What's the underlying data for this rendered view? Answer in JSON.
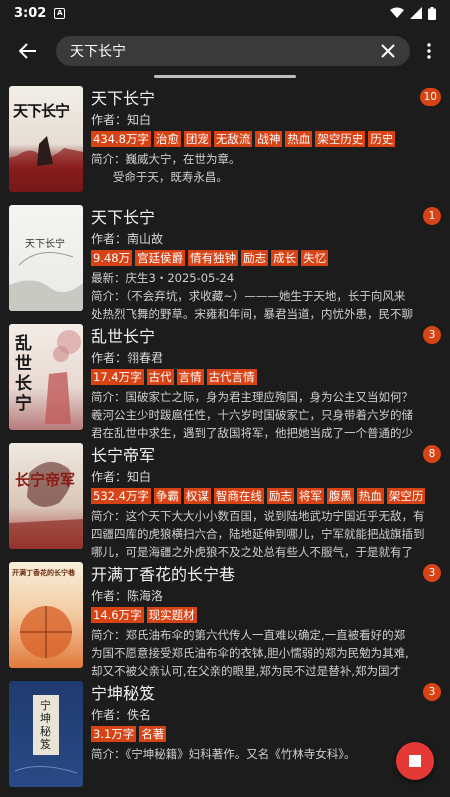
{
  "status": {
    "time": "3:02",
    "notif_letter": "A"
  },
  "search": {
    "value": "天下长宁"
  },
  "results": [
    {
      "title": "天下长宁",
      "author_label": "作者：",
      "author": "知白",
      "tags": [
        "434.8万字",
        "治愈",
        "团宠",
        "无敌流",
        "战神",
        "热血",
        "架空历史",
        "历史"
      ],
      "desc_line1": "简介：巍威大宁，在世为章。",
      "desc_line2": "      受命于天，既寿永昌。",
      "badge": "10",
      "cover_text": "天下长宁"
    },
    {
      "title": "天下长宁",
      "author_label": "作者：",
      "author": "南山故",
      "tags": [
        "9.48万",
        "宫廷侯爵",
        "情有独钟",
        "励志",
        "成长",
        "失忆"
      ],
      "desc_line1": "最新：庆生3・2025-05-24",
      "desc_line2": "简介：（不会弃坑，求收藏~）———她生于天地，长于向风来处热烈飞舞的野草。宋雍和年间，暴君当道，内忧外患，民不聊生，",
      "badge": "1",
      "cover_text": "天下长宁"
    },
    {
      "title": "乱世长宁",
      "author_label": "作者：",
      "author": "翎春君",
      "tags": [
        "17.4万字",
        "古代",
        "言情",
        "古代言情"
      ],
      "desc_line1": "简介：国破家亡之际，身为君主理应殉国，身为公主又当如何？羲河公主少时跋扈任性，十六岁时国破家亡，只身带着六岁的储君在乱世中求生，遇到了敌国将军，他把她当成了一个普通的少女，",
      "desc_line2": "",
      "badge": "3",
      "cover_text": "乱世长宁"
    },
    {
      "title": "长宁帝军",
      "author_label": "作者：",
      "author": "知白",
      "tags": [
        "532.4万字",
        "争霸",
        "权谋",
        "智商在线",
        "励志",
        "将军",
        "腹黑",
        "热血",
        "架空历"
      ],
      "desc_line1": "简介：这个天下大大小小数百国，说到陆地武功宁国近乎无敌，有四疆四库的虎狼横扫六合，陆地延伸到哪儿，宁军就能把战旗插到哪儿，可是海疆之外虎狼不及之处总有些人不服气，于是就有了",
      "desc_line2": "",
      "badge": "8",
      "cover_text": "长宁帝军"
    },
    {
      "title": "开满丁香花的长宁巷",
      "author_label": "作者：",
      "author": "陈海洛",
      "tags": [
        "14.6万字",
        "现实题材"
      ],
      "desc_line1": "简介：郑氏油布伞的第六代传人一直难以确定,一直被看好的郑为国不愿意接受郑氏油布伞的衣钵,胆小懦弱的郑为民勉为其难,却又不被父亲认可,在父亲的眼里,郑为民不过是替补,郑为国才是。父亲",
      "desc_line2": "",
      "badge": "3",
      "cover_text": "开满丁香花的长宁巷"
    },
    {
      "title": "宁坤秘笈",
      "author_label": "作者：",
      "author": "佚名",
      "tags": [
        "3.1万字",
        "名著"
      ],
      "desc_line1": "简介：《宁坤秘籍》妇科著作。又名《竹林寺女科》。",
      "desc_line2": "",
      "badge": "3",
      "cover_text": "宁坤秘笈"
    }
  ],
  "colors": {
    "accent": "#d84315",
    "background": "#1c1c1c",
    "search_bg": "#3a3a3a",
    "fab": "#e53935"
  },
  "icons": {
    "back": "arrow-left-icon",
    "clear": "close-icon",
    "menu": "more-vertical-icon",
    "fab": "stop-icon"
  }
}
